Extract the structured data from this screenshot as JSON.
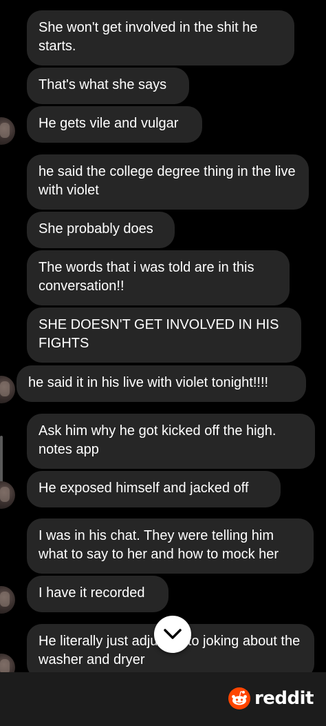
{
  "messages": [
    {
      "text": "She won't get involved in the shit he starts."
    },
    {
      "text": "That's what she says"
    },
    {
      "text": "He gets vile and vulgar"
    },
    {
      "text": "he said the college degree thing in the live with violet"
    },
    {
      "text": "She probably does"
    },
    {
      "text": "The words that i was told are in this conversation!!"
    },
    {
      "text": "SHE DOESN'T GET INVOLVED IN HIS FIGHTS"
    },
    {
      "text": "he said it in his live with violet tonight!!!!"
    },
    {
      "text": "Ask him why he got kicked off the high. notes app"
    },
    {
      "text": "He exposed himself and jacked off"
    },
    {
      "text": "I was in his chat. They were telling him what to say to her and how to mock her"
    },
    {
      "text": "I have it recorded"
    },
    {
      "text": "He literally just adjusted to joking about the washer and dryer"
    }
  ],
  "jump_button": {
    "icon": "chevron-down-icon"
  },
  "footer": {
    "brand": "reddit",
    "icon": "reddit-logo-icon"
  },
  "colors": {
    "background": "#000000",
    "bubble": "#262626",
    "footer": "#1c1c1c",
    "reddit_orange": "#ff4500"
  }
}
